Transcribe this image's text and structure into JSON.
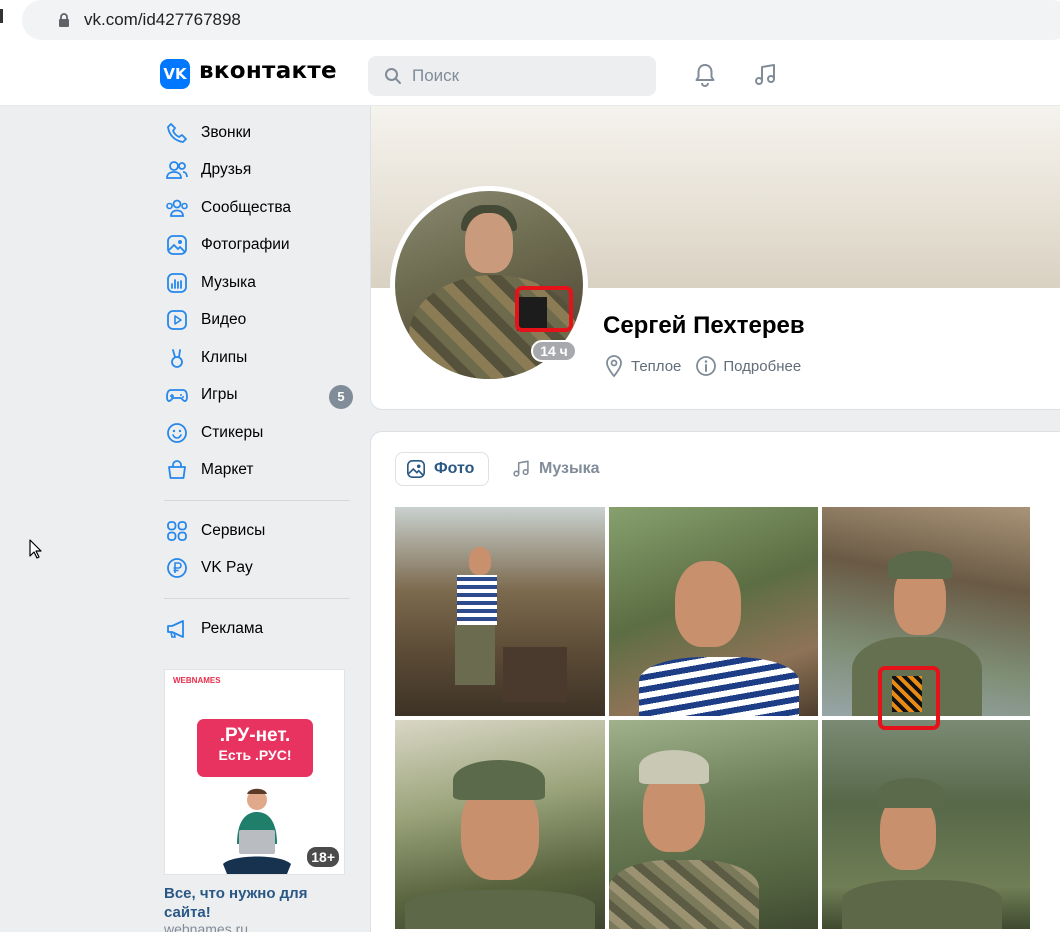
{
  "browser": {
    "url": "vk.com/id427767898"
  },
  "header": {
    "logo_mark": "VK",
    "logo_text": "вконтакте",
    "search_placeholder": "Поиск",
    "icons": [
      "bell-icon",
      "music-icon"
    ]
  },
  "sidebar": {
    "items": [
      {
        "label": "Звонки",
        "icon": "phone-icon"
      },
      {
        "label": "Друзья",
        "icon": "friends-icon"
      },
      {
        "label": "Сообщества",
        "icon": "communities-icon"
      },
      {
        "label": "Фотографии",
        "icon": "photos-icon"
      },
      {
        "label": "Музыка",
        "icon": "music-icon"
      },
      {
        "label": "Видео",
        "icon": "video-icon"
      },
      {
        "label": "Клипы",
        "icon": "clips-icon"
      },
      {
        "label": "Игры",
        "icon": "games-icon",
        "badge": "5"
      },
      {
        "label": "Стикеры",
        "icon": "stickers-icon"
      },
      {
        "label": "Маркет",
        "icon": "market-icon"
      }
    ],
    "secondary": [
      {
        "label": "Сервисы",
        "icon": "services-icon"
      },
      {
        "label": "VK Pay",
        "icon": "vkpay-icon"
      }
    ],
    "ads_link": {
      "label": "Реклама",
      "icon": "megaphone-icon"
    }
  },
  "ad": {
    "brand": "WEBNAMES",
    "line1": ".РУ-нет.",
    "line2": "Есть .РУС!",
    "age": "18+",
    "title": "Все, что нужно для сайта!",
    "domain": "webnames.ru"
  },
  "profile": {
    "name": "Сергей Пехтерев",
    "last_seen": "14 ч",
    "location": "Теплое",
    "details_link": "Подробнее"
  },
  "media": {
    "tabs": [
      {
        "label": "Фото",
        "active": true,
        "icon": "photo-icon"
      },
      {
        "label": "Музыка",
        "active": false,
        "icon": "music-icon"
      }
    ],
    "photos": 6
  },
  "colors": {
    "vk_blue": "#0077ff",
    "link": "#2a5885",
    "highlight": "#e6121a",
    "background": "#edeef0"
  }
}
